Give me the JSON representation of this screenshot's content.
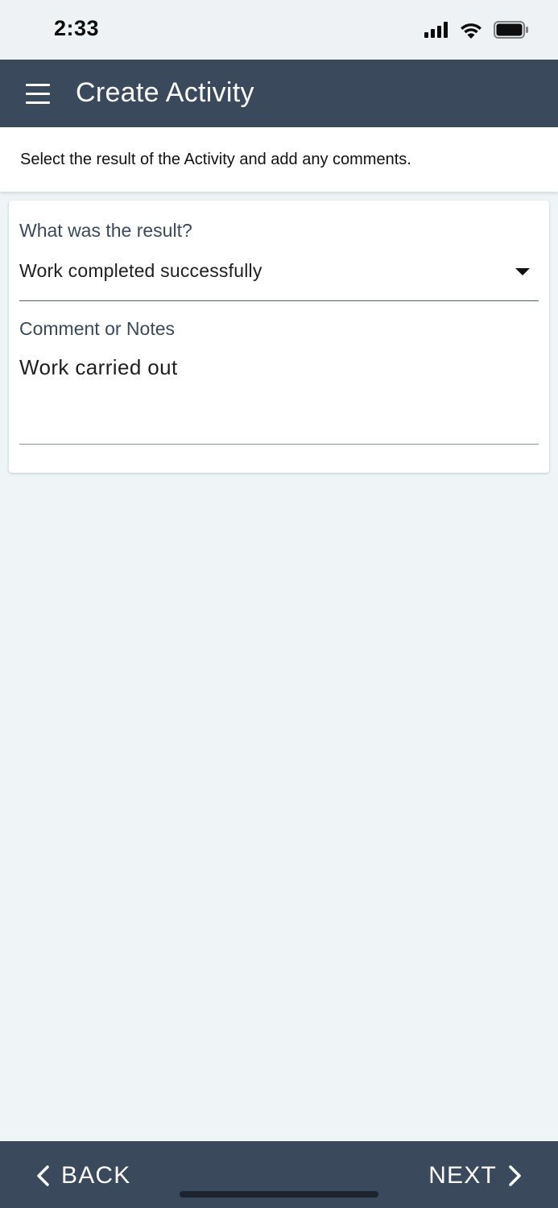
{
  "status_bar": {
    "time": "2:33",
    "icons": [
      "cellular-signal-icon",
      "wifi-icon",
      "battery-icon"
    ]
  },
  "app_bar": {
    "title": "Create Activity",
    "menu_icon": "hamburger-menu-icon"
  },
  "instruction": {
    "text": "Select the result of the Activity and add any comments."
  },
  "form": {
    "result_label": "What was the result?",
    "result_value": "Work completed successfully",
    "notes_label": "Comment or Notes",
    "notes_value": "Work carried out"
  },
  "bottom_nav": {
    "back_label": "BACK",
    "next_label": "NEXT",
    "back_icon": "chevron-left-icon",
    "next_icon": "chevron-right-icon"
  },
  "colors": {
    "app_bar": "#3a4a5c",
    "background": "#eff4f7",
    "label": "#3a4a5c"
  }
}
